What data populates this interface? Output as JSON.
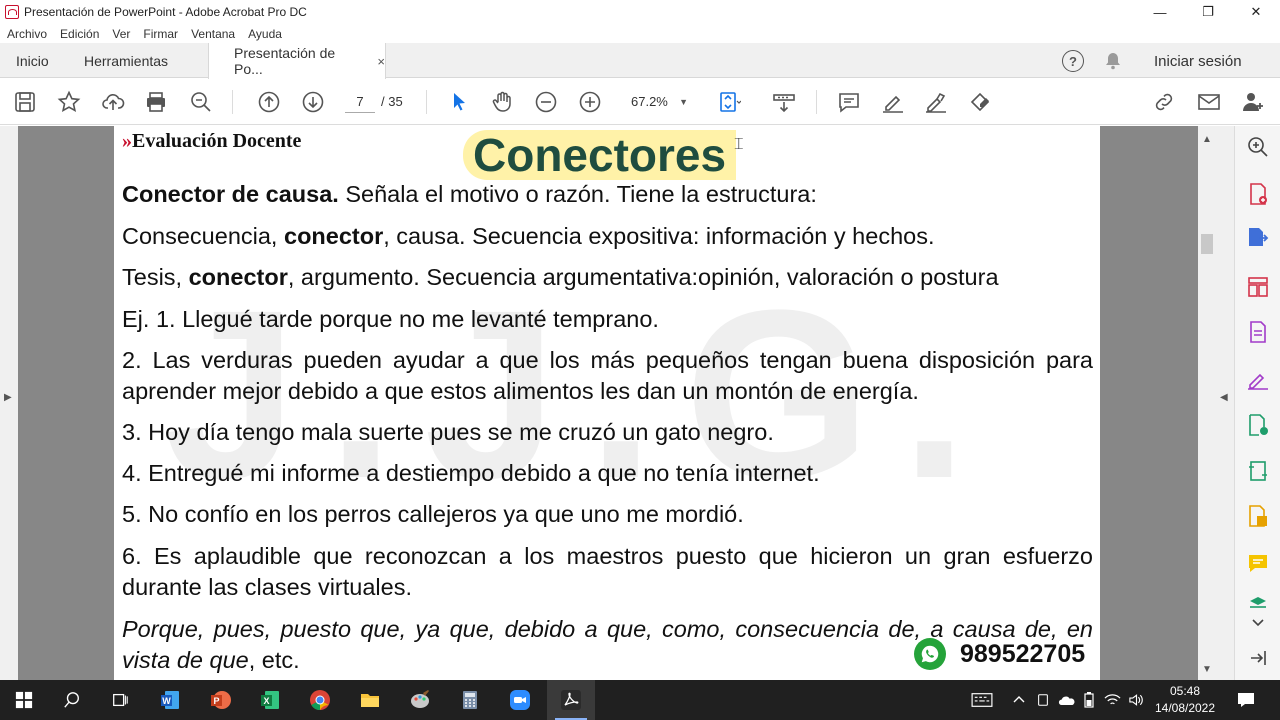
{
  "window": {
    "title": "Presentación de PowerPoint - Adobe Acrobat Pro DC",
    "minimize": "—",
    "restore": "❐",
    "close": "✕"
  },
  "menu": [
    "Archivo",
    "Edición",
    "Ver",
    "Firmar",
    "Ventana",
    "Ayuda"
  ],
  "tabs": {
    "home": "Inicio",
    "tools": "Herramientas",
    "document": "Presentación de Po...",
    "close": "×"
  },
  "header": {
    "help": "?",
    "signin": "Iniciar sesión"
  },
  "toolbar": {
    "page_current": "7",
    "page_total": "/ 35",
    "zoom": "67.2%",
    "zoom_caret": "▼"
  },
  "document": {
    "brand_chevrons": "»",
    "brand": "Evaluación Docente",
    "title": "Conectores",
    "watermark": "J.J.G.",
    "line1_bold": "Conector de causa.",
    "line1_rest": " Señala el motivo o razón. Tiene la estructura:",
    "line2_a": "Consecuencia, ",
    "line2_bold": "conector",
    "line2_b": ", causa. Secuencia expositiva: información y hechos.",
    "line3_a": "Tesis, ",
    "line3_bold": "conector",
    "line3_b": ", argumento. Secuencia argumentativa:opinión, valoración o postura",
    "ex1": "Ej. 1. Llegué tarde porque no me levanté temprano.",
    "ex2": "2. Las verduras pueden ayudar a que los más pequeños tengan buena disposición para aprender mejor debido a que estos alimentos les dan un montón de energía.",
    "ex3": "3. Hoy día tengo mala suerte pues se me cruzó un gato negro.",
    "ex4": "4. Entregué mi informe a destiempo debido a que no tenía internet.",
    "ex5": "5. No confío en los perros callejeros ya que uno me mordió.",
    "ex6": "6. Es aplaudible que reconozcan a los maestros puesto que hicieron un gran esfuerzo durante las clases virtuales.",
    "connectors_italic": "Porque, pues, puesto que, ya que, debido a que, como, consecuencia de, a causa de, en vista de que",
    "connectors_rest": ", etc.",
    "phone": "989522705"
  },
  "taskbar": {
    "time": "05:48",
    "date": "14/08/2022"
  },
  "colors": {
    "title_green": "#1f4d3f",
    "highlight": "#fff2a8",
    "brand_red": "#c8102e",
    "whatsapp": "#25a33a",
    "taskbar": "#202020"
  },
  "icons": {
    "toolbar": [
      "save-icon",
      "star-icon",
      "upload-icon",
      "print-icon",
      "zoom-search-icon",
      "page-up-icon",
      "page-down-icon",
      "select-arrow-icon",
      "hand-icon",
      "zoom-out-icon",
      "zoom-in-icon",
      "fit-page-icon",
      "scroll-mode-icon",
      "comment-icon",
      "highlight-pen-icon",
      "sign-icon",
      "edit-pdf-icon",
      "link-icon",
      "email-icon",
      "add-user-icon"
    ],
    "right_panel": [
      "search-icon",
      "create-pdf-icon",
      "export-pdf-icon",
      "organize-pages-icon",
      "edit-text-icon",
      "fill-sign-icon",
      "export-icon",
      "compress-icon",
      "pdf-report-icon",
      "comment-icon",
      "scan-icon",
      "more-icon"
    ]
  }
}
